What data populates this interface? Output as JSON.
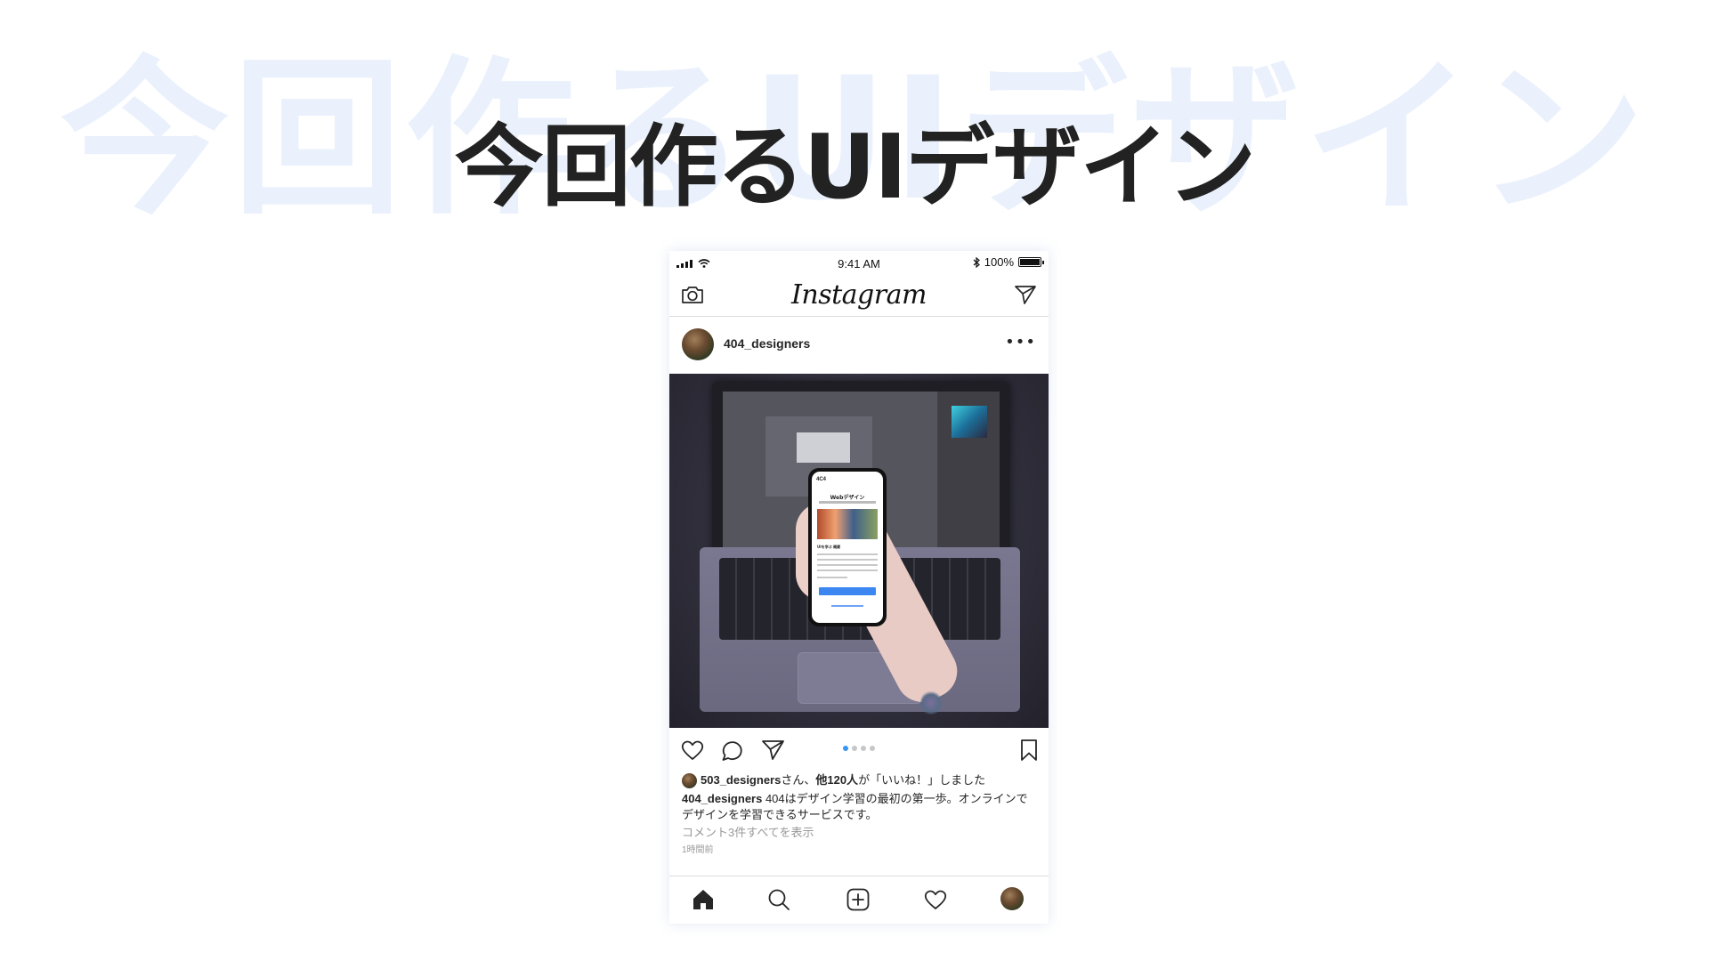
{
  "slide": {
    "background_title": "今回作るUIデザイン",
    "title": "今回作るUIデザイン"
  },
  "status_bar": {
    "time": "9:41 AM",
    "battery": "100%"
  },
  "app": {
    "logo": "Instagram"
  },
  "post": {
    "username": "404_designers",
    "more": "•••",
    "carousel": {
      "count": 4,
      "active": 1
    },
    "liked_by_user": "503_designers",
    "liked_by_rest": "さん、",
    "liked_by_others": "他120人",
    "liked_by_suffix": "が「いいね！」しました",
    "caption_user": "404_designers",
    "caption_text": " 404はデザイン学習の最初の第一歩。オンラインでデザインを学習できるサービスです。",
    "comments_link": "コメント3件すべてを表示",
    "time_ago": "1時間前"
  },
  "photo_phone": {
    "brand": "4C4",
    "title": "Webデザイン",
    "section": "UIを学ぶ 概要"
  },
  "colors": {
    "accent": "#3897f0",
    "text": "#262626",
    "muted": "#999999",
    "watermark": "#eaf1fc"
  },
  "icons": {
    "topbar": [
      "camera-icon",
      "direct-message-icon"
    ],
    "actions": [
      "heart-icon",
      "comment-icon",
      "share-icon",
      "bookmark-icon"
    ],
    "tabbar": [
      "home-icon",
      "search-icon",
      "add-post-icon",
      "activity-heart-icon",
      "profile-avatar"
    ]
  }
}
